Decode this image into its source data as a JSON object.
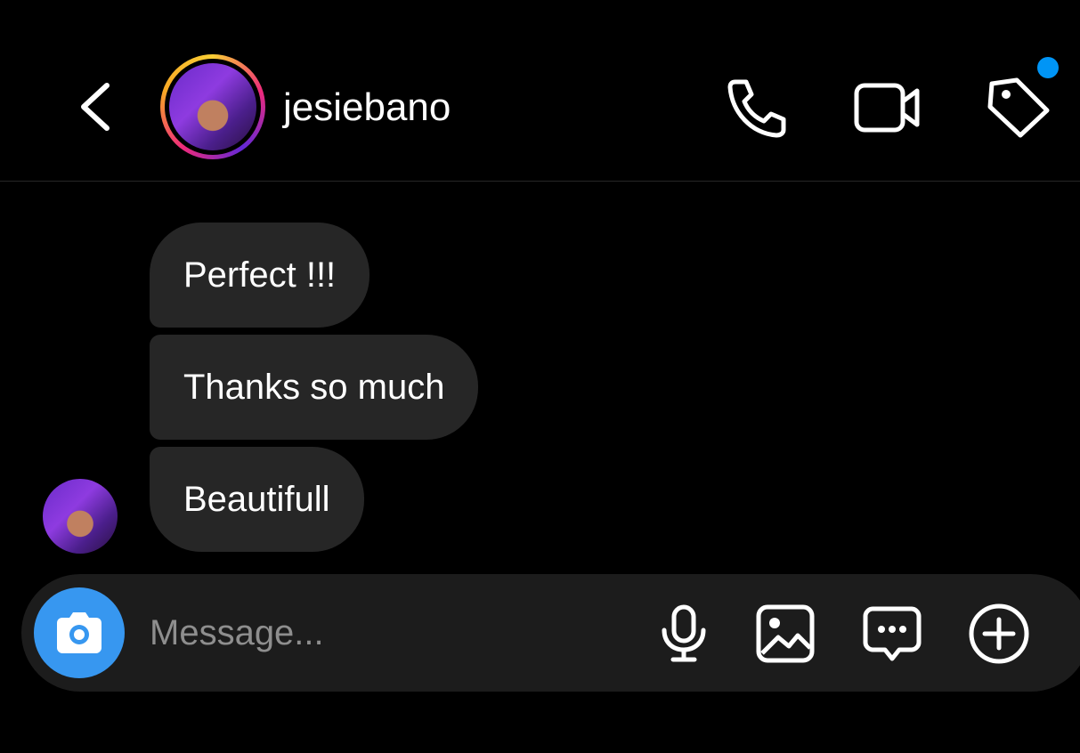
{
  "header": {
    "username": "jesiebano",
    "back_icon": "chevron-left-icon",
    "actions": [
      "phone-icon",
      "video-camera-icon",
      "tag-icon"
    ],
    "notification_dot_color": "#0095f6"
  },
  "messages": [
    {
      "text": "Perfect !!!"
    },
    {
      "text": "Thanks so much"
    },
    {
      "text": "Beautifull"
    }
  ],
  "composer": {
    "placeholder": "Message...",
    "camera_button_color": "#3797f0",
    "icons": [
      "camera-icon",
      "microphone-icon",
      "image-icon",
      "sticker-chat-icon",
      "plus-circle-icon"
    ]
  }
}
